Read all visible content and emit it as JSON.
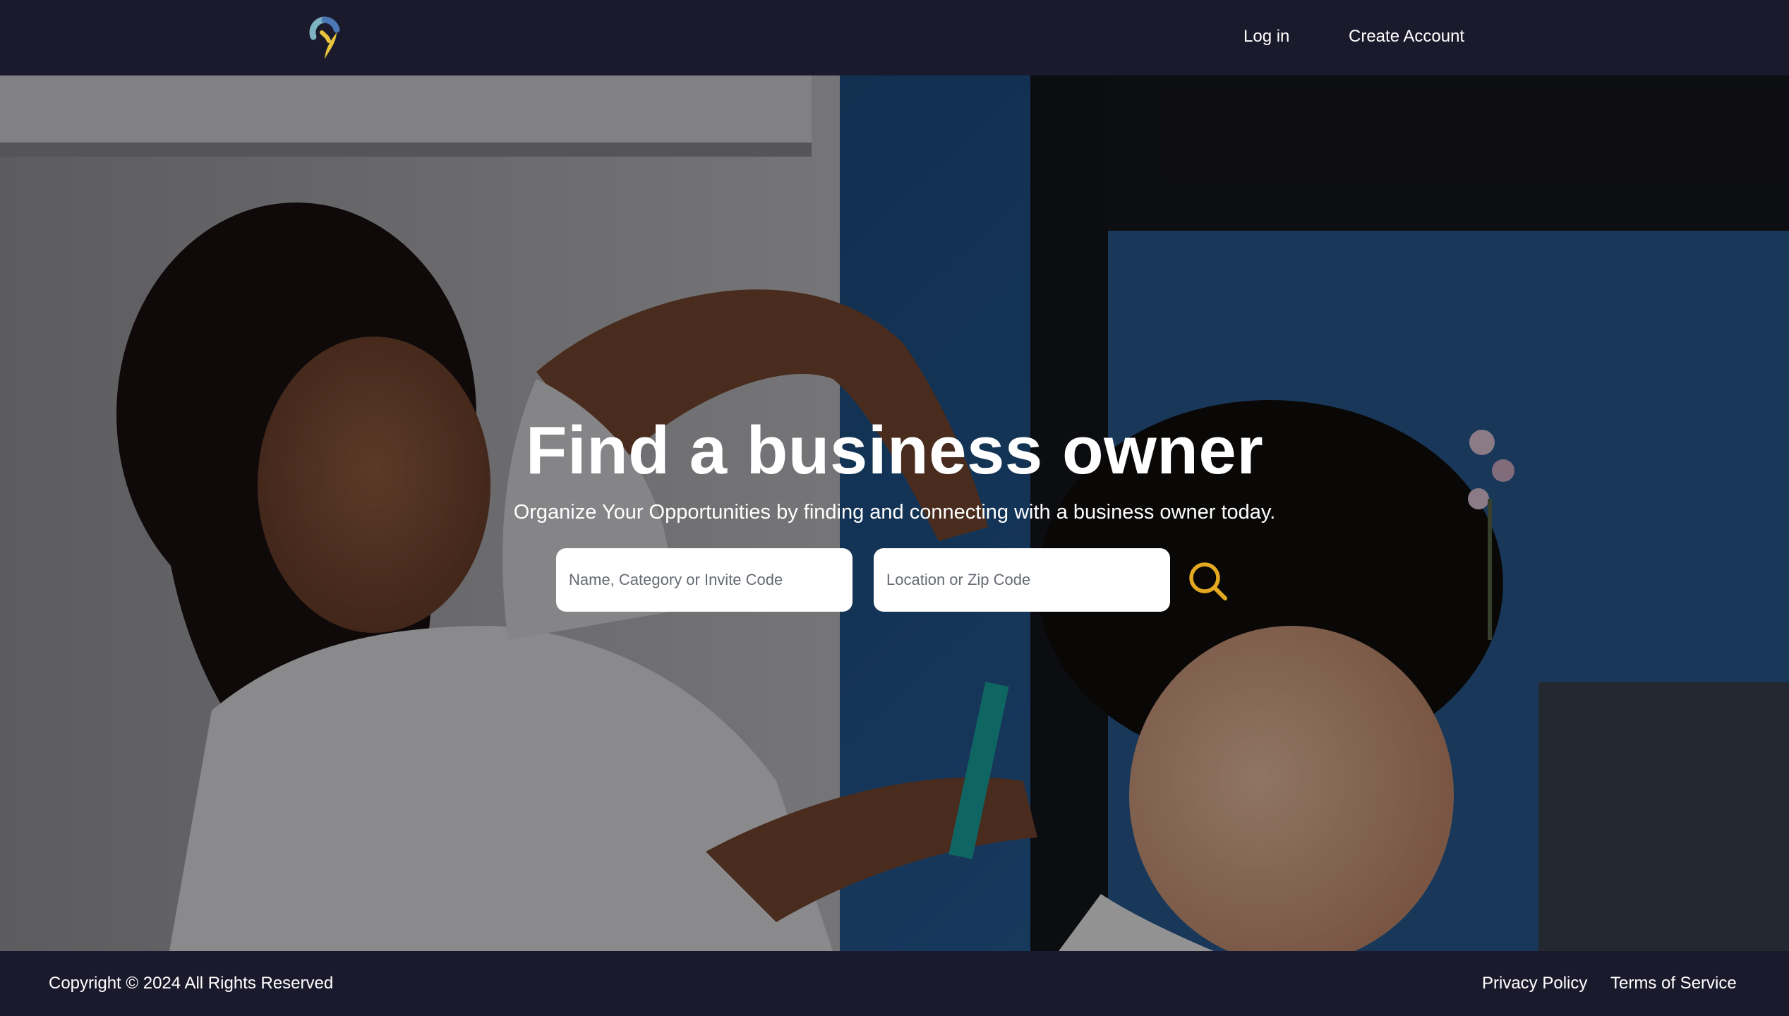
{
  "header": {
    "logo_icon": "location-pin-logo-icon",
    "login_label": "Log in",
    "create_account_label": "Create Account"
  },
  "hero": {
    "background_image": "hairdresser styling a client's hair in a salon",
    "title": "Find a business owner",
    "subtitle": "Organize Your Opportunities by finding and connecting with a business owner today.",
    "search": {
      "name_placeholder": "Name, Category or Invite Code",
      "name_value": "",
      "location_placeholder": "Location or Zip Code",
      "location_value": "",
      "button_icon": "search-icon"
    }
  },
  "footer": {
    "copyright": "Copyright © 2024 All Rights Reserved",
    "privacy_label": "Privacy Policy",
    "terms_label": "Terms of Service"
  },
  "colors": {
    "header_bg": "#1b1a2c",
    "footer_bg": "#1b1a2c",
    "accent": "#e3a920",
    "text": "#ffffff",
    "input_bg": "#ffffff"
  }
}
